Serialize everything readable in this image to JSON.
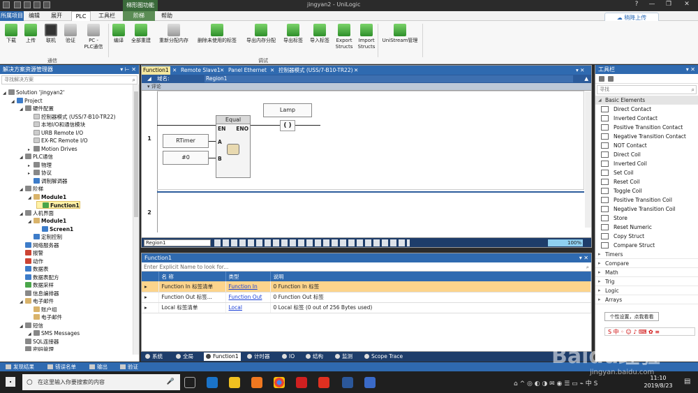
{
  "window": {
    "title": "jingyan2 - UniLogic",
    "context_tab": "梯形图功能",
    "controls": [
      "?",
      "—",
      "❐",
      "✕"
    ]
  },
  "menu": {
    "items": [
      "所属项目",
      "编辑",
      "展开",
      "PLC",
      "工具栏",
      "阶梯",
      "帮助"
    ],
    "active": "PLC",
    "cloud_button": "稍降上传"
  },
  "ribbon": {
    "buttons": [
      {
        "label": "下载",
        "icon": "download-icon"
      },
      {
        "label": "上传",
        "icon": "upload-icon"
      },
      {
        "label": "联机",
        "icon": "online-icon"
      },
      {
        "label": "验证",
        "icon": "verify-icon"
      },
      {
        "label": "PC -\nPLC通信",
        "icon": "pc-plc-icon"
      },
      {
        "label": "编译",
        "icon": "build-icon"
      },
      {
        "label": "全部重建",
        "icon": "rebuild-icon"
      },
      {
        "label": "重新分配内存",
        "icon": "memory-icon"
      },
      {
        "label": "删除未使用的标签",
        "icon": "delete-tags-icon"
      },
      {
        "label": "导出内存分配",
        "icon": "export-memory-icon"
      },
      {
        "label": "导出标签",
        "icon": "export-tags-icon"
      },
      {
        "label": "导入标签",
        "icon": "import-tags-icon"
      },
      {
        "label": "Export\nStructs",
        "icon": "export-structs-icon"
      },
      {
        "label": "Import\nStructs",
        "icon": "import-structs-icon"
      },
      {
        "label": "UniStream管理",
        "icon": "unistream-icon"
      }
    ],
    "group_comm": "通信",
    "group_debug": "调试"
  },
  "solution_explorer": {
    "title": "解决方案资源管理器",
    "search_placeholder": "寻找解决方案",
    "tree": [
      {
        "label": "Solution 'jingyan2'",
        "level": 0,
        "icon": "solution"
      },
      {
        "label": "Project",
        "level": 1,
        "icon": "project"
      },
      {
        "label": "硬件配置",
        "level": 2,
        "icon": "hardware"
      },
      {
        "label": "控制器模式 (USS/7-B10-TR22)",
        "level": 3,
        "icon": "controller"
      },
      {
        "label": "本地I/O和通信模块",
        "level": 3,
        "icon": "io"
      },
      {
        "label": "URB Remote I/O",
        "level": 3,
        "icon": "io"
      },
      {
        "label": "EX-RC Remote I/O",
        "level": 3,
        "icon": "io"
      },
      {
        "label": "Motion Drives",
        "level": 3,
        "icon": "motion"
      },
      {
        "label": "PLC通信",
        "level": 2,
        "icon": "comm"
      },
      {
        "label": "物理",
        "level": 3,
        "icon": "physical"
      },
      {
        "label": "协议",
        "level": 3,
        "icon": "protocol"
      },
      {
        "label": "调制解调器",
        "level": 3,
        "icon": "modem"
      },
      {
        "label": "阶梯",
        "level": 2,
        "icon": "ladder"
      },
      {
        "label": "Module1",
        "level": 3,
        "icon": "folder",
        "bold": true
      },
      {
        "label": "Function1",
        "level": 4,
        "icon": "function",
        "bold": true,
        "selected": true
      },
      {
        "label": "人机界面",
        "level": 2,
        "icon": "hmi"
      },
      {
        "label": "Module1",
        "level": 3,
        "icon": "folder",
        "bold": true
      },
      {
        "label": "Screen1",
        "level": 4,
        "icon": "screen",
        "bold": true
      },
      {
        "label": "定制控制",
        "level": 3,
        "icon": "custom"
      },
      {
        "label": "网络服务器",
        "level": 2,
        "icon": "web"
      },
      {
        "label": "报警",
        "level": 2,
        "icon": "alarm"
      },
      {
        "label": "动作",
        "level": 2,
        "icon": "action"
      },
      {
        "label": "数据表",
        "level": 2,
        "icon": "table"
      },
      {
        "label": "数据表配方",
        "level": 2,
        "icon": "recipe"
      },
      {
        "label": "数据采样",
        "level": 2,
        "icon": "sampler"
      },
      {
        "label": "信息编排器",
        "level": 2,
        "icon": "message"
      },
      {
        "label": "电子邮件",
        "level": 2,
        "icon": "email"
      },
      {
        "label": "账户组",
        "level": 3,
        "icon": "folder"
      },
      {
        "label": "电子邮件",
        "level": 3,
        "icon": "folder"
      },
      {
        "label": "短信",
        "level": 2,
        "icon": "sms"
      },
      {
        "label": "SMS Messages",
        "level": 3,
        "icon": "sms"
      },
      {
        "label": "SQL连接器",
        "level": 2,
        "icon": "sql"
      },
      {
        "label": "密码管理",
        "level": 2,
        "icon": "password"
      }
    ]
  },
  "editor": {
    "tabs": [
      "Function1",
      "Remote Slave1",
      "Panel Ethernet",
      "控制器模式 (USS/7-B10-TR22)"
    ],
    "active_tab": "Function1",
    "region_label": "域名:",
    "region_name": "Region1",
    "comment_label": "评论",
    "rungs": [
      "1",
      "2"
    ],
    "function_block": {
      "title": "Equal",
      "en": "EN",
      "eno": "ENO",
      "in_a": "A",
      "in_b": "B"
    },
    "operand_a": "RTimer",
    "operand_b": "#0",
    "coil_name": "Lamp",
    "coil_symbol": "( )",
    "region_select": "Region1",
    "zoom": "100%"
  },
  "function_panel": {
    "title": "Function1",
    "filter_placeholder": "Enter Explicit Name to look for...",
    "columns": [
      "名 称",
      "类型",
      "说明"
    ],
    "rows": [
      {
        "name": "Function In 标签清单",
        "type": "Function In",
        "desc": "0 Function In 标签",
        "selected": true
      },
      {
        "name": "Function Out 标签...",
        "type": "Function Out",
        "desc": "0 Function Out 标签"
      },
      {
        "name": "Local 标签清单",
        "type": "Local",
        "desc": "0 Local 标签 (0 out of 256 Bytes used)"
      }
    ]
  },
  "bottom_tabs": [
    "系统",
    "全局",
    "Function1",
    "计时器",
    "IO",
    "结构",
    "监测",
    "Scope Trace"
  ],
  "bottom_active": "Function1",
  "toolbox": {
    "title": "工具栏",
    "search_placeholder": "寻找",
    "open_category": "Basic Elements",
    "items": [
      "Direct Contact",
      "Inverted Contact",
      "Positive Transition Contact",
      "Negative Transition Contact",
      "NOT Contact",
      "Direct Coil",
      "Inverted Coil",
      "Set Coil",
      "Reset Coil",
      "Toggle Coil",
      "Positive Transition Coil",
      "Negative Transition Coil",
      "Store",
      "Reset Numeric",
      "Copy Struct",
      "Compare Struct"
    ],
    "categories": [
      "Timers",
      "Compare",
      "Math",
      "Trig",
      "Logic",
      "Arrays"
    ],
    "tooltip": "个性设置，点我看看"
  },
  "footer": {
    "tabs": [
      "发现结果",
      "错误名单",
      "输出",
      "验证"
    ]
  },
  "taskbar": {
    "search_placeholder": "在这里输入你要搜索的内容",
    "time": "11:10",
    "date": "2019/8/23"
  },
  "watermark": {
    "brand": "Baidu经验",
    "url": "jingyan.baidu.com"
  },
  "colors": {
    "accent": "#2f6ab0",
    "selection": "#fcd48c",
    "ribbon_icon": "#2e8f2a"
  }
}
